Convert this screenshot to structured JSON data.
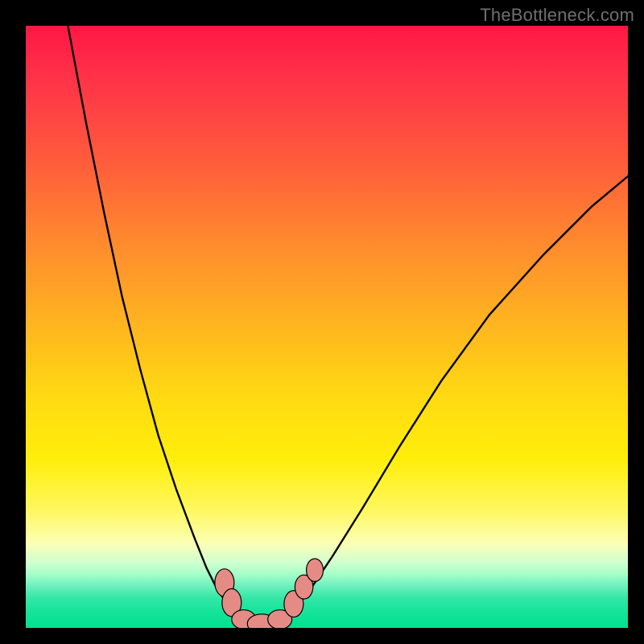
{
  "watermark": "TheBottleneck.com",
  "chart_data": {
    "type": "line",
    "title": "",
    "xlabel": "",
    "ylabel": "",
    "xlim": [
      0,
      100
    ],
    "ylim": [
      0,
      100
    ],
    "grid": false,
    "legend": false,
    "annotations": [],
    "series": [
      {
        "name": "left-curve",
        "x": [
          7,
          10,
          13,
          16,
          19,
          22,
          25,
          28,
          30,
          32,
          34,
          35.5,
          37
        ],
        "y": [
          100,
          84,
          69,
          55,
          43,
          32,
          23,
          15,
          10,
          6,
          3.5,
          2,
          1
        ]
      },
      {
        "name": "right-curve",
        "x": [
          42,
          44,
          47,
          51,
          56,
          62,
          69,
          77,
          86,
          94,
          100
        ],
        "y": [
          1,
          2.5,
          6,
          12,
          20,
          30,
          41,
          52,
          62,
          70,
          75
        ]
      },
      {
        "name": "valley-floor",
        "x": [
          37,
          38.5,
          40,
          41,
          42
        ],
        "y": [
          1,
          0.6,
          0.5,
          0.6,
          1
        ]
      }
    ],
    "markers": [
      {
        "series": "left-curve",
        "cx": 33.0,
        "cy": 7.5,
        "rx": 1.6,
        "ry": 2.3
      },
      {
        "series": "left-curve",
        "cx": 34.2,
        "cy": 4.2,
        "rx": 1.6,
        "ry": 2.3
      },
      {
        "series": "valley-floor",
        "cx": 36.2,
        "cy": 1.4,
        "rx": 2.0,
        "ry": 1.6
      },
      {
        "series": "valley-floor",
        "cx": 39.2,
        "cy": 0.7,
        "rx": 2.4,
        "ry": 1.6
      },
      {
        "series": "valley-floor",
        "cx": 42.2,
        "cy": 1.4,
        "rx": 2.0,
        "ry": 1.6
      },
      {
        "series": "right-curve",
        "cx": 44.5,
        "cy": 4.0,
        "rx": 1.6,
        "ry": 2.2
      },
      {
        "series": "right-curve",
        "cx": 46.2,
        "cy": 6.8,
        "rx": 1.5,
        "ry": 2.0
      },
      {
        "series": "right-curve",
        "cx": 48.0,
        "cy": 9.6,
        "rx": 1.4,
        "ry": 1.9
      }
    ],
    "marker_style": {
      "fill": "#e58b85",
      "stroke": "#000000",
      "stroke_width": 1.2
    },
    "line_style": {
      "stroke": "#000000",
      "stroke_width": 2.4
    }
  }
}
